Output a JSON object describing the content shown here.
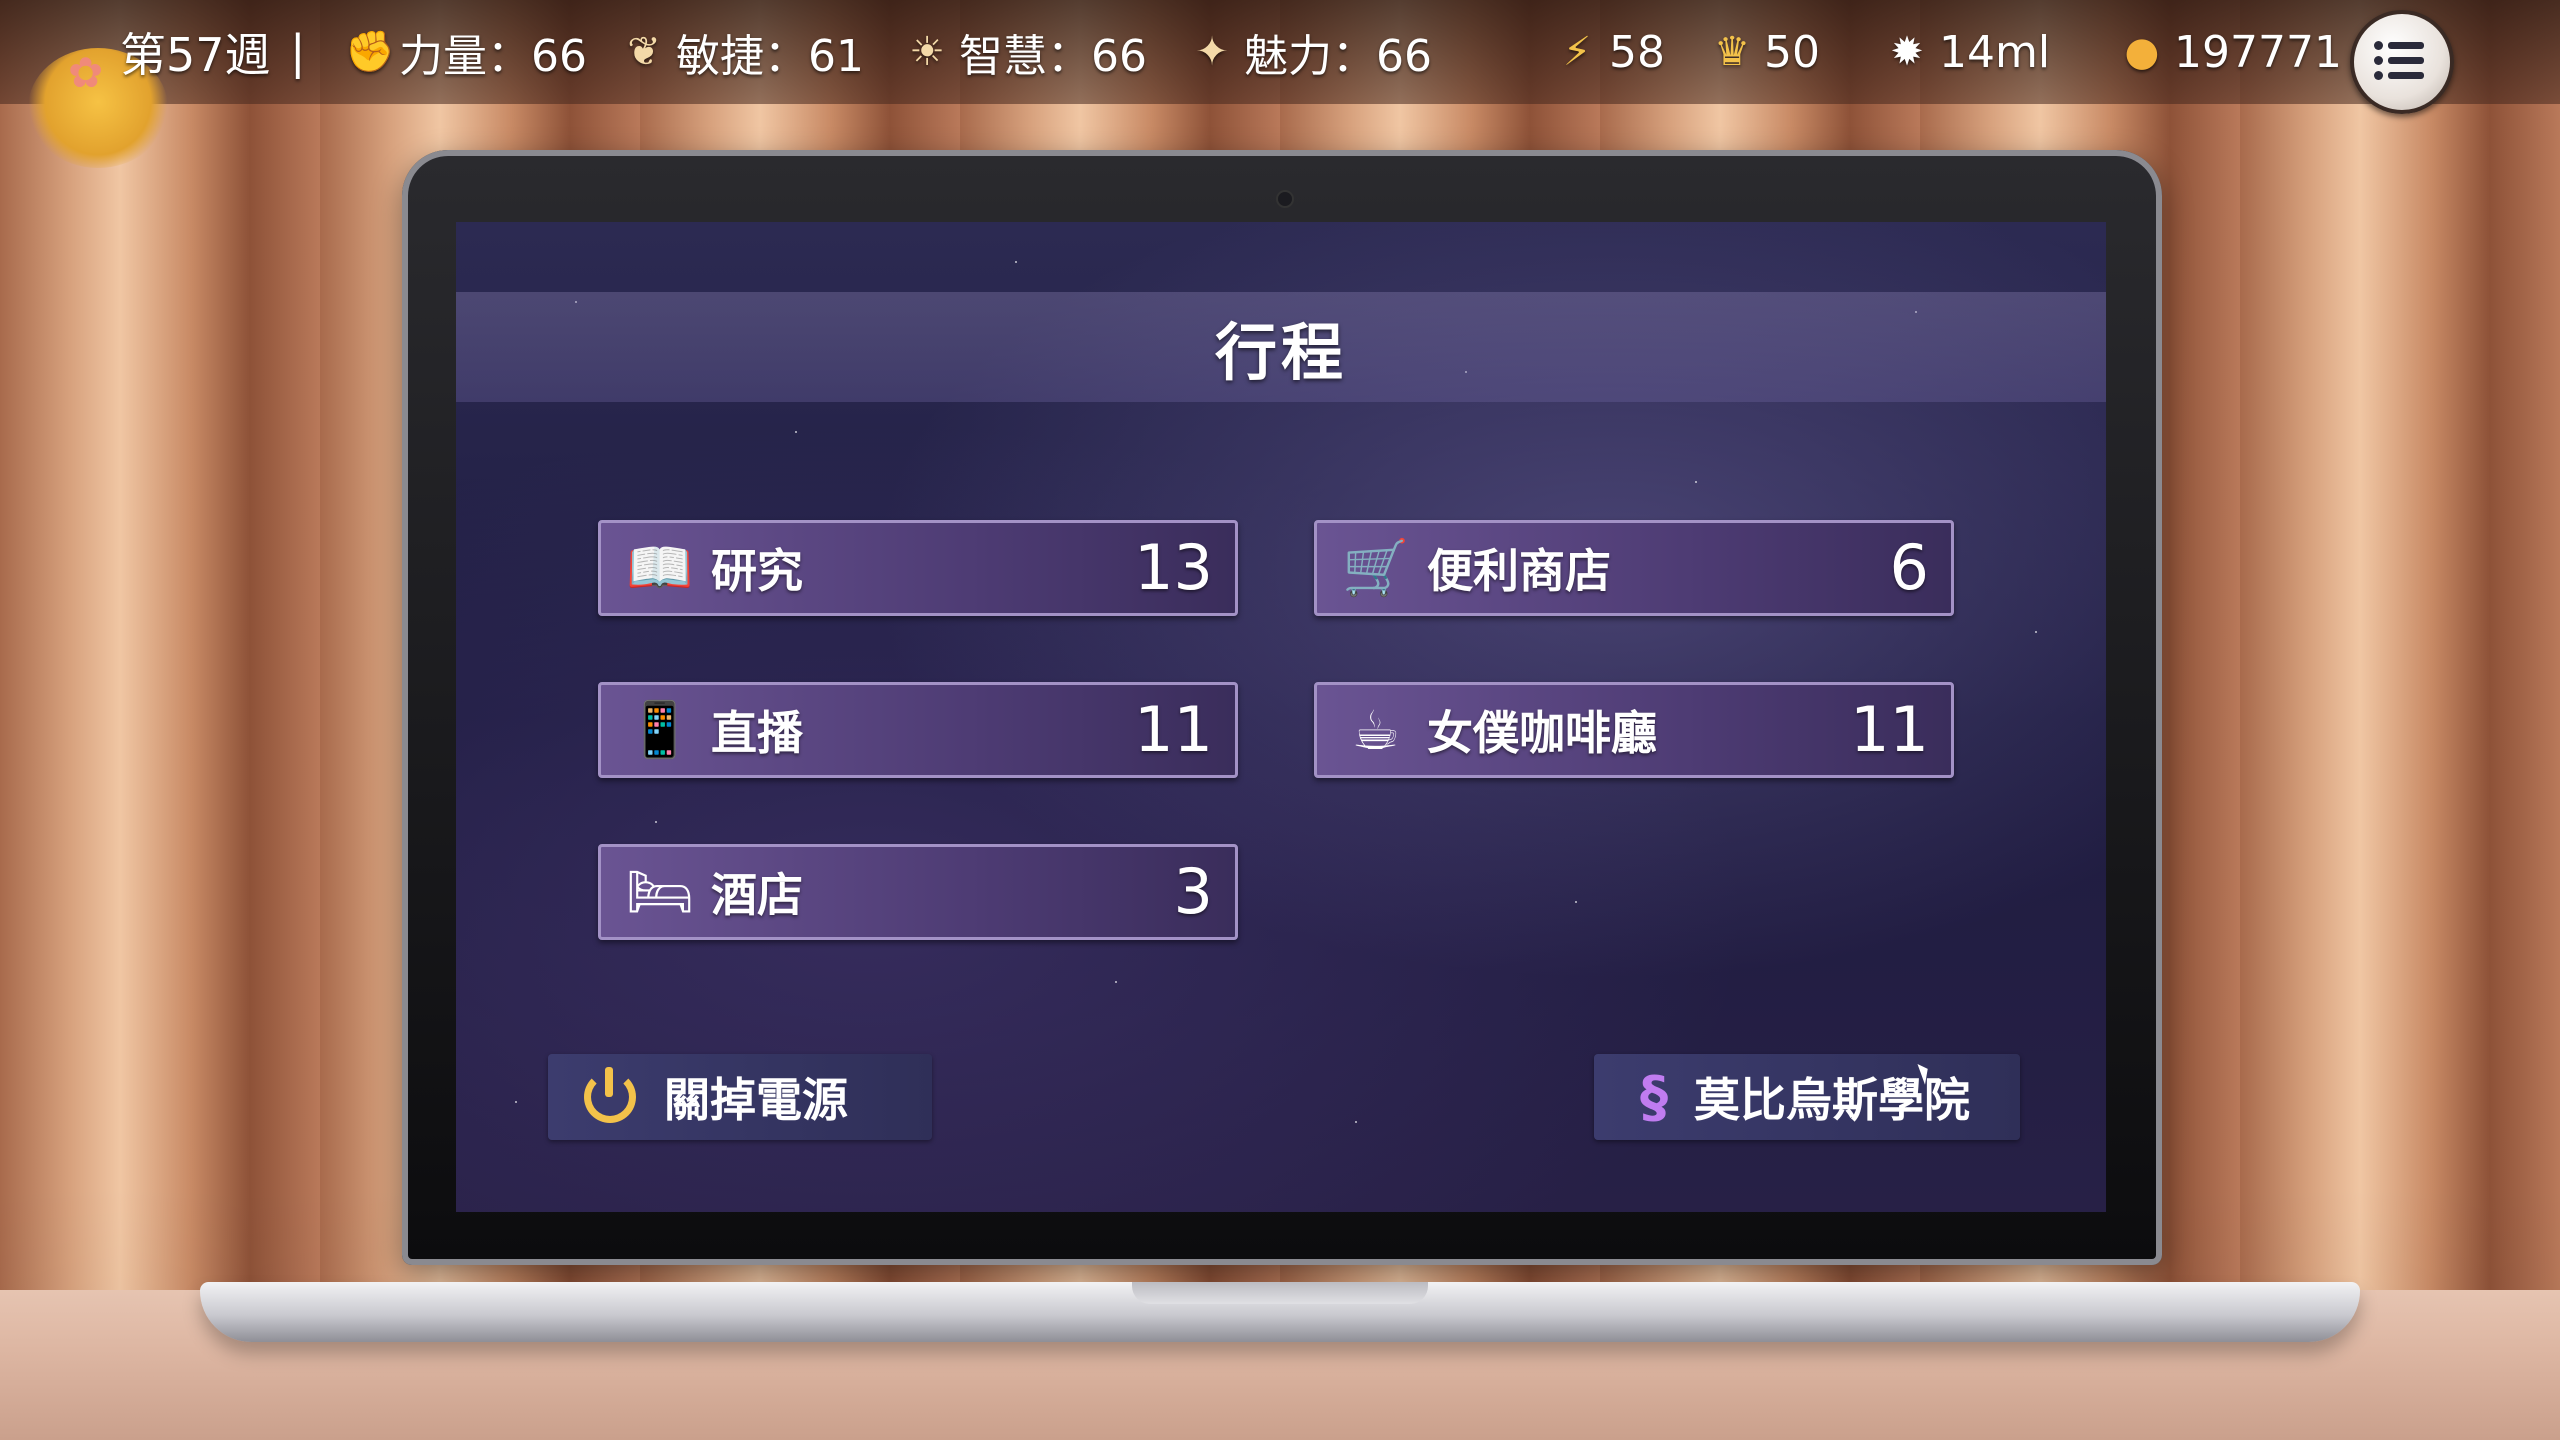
{
  "topbar": {
    "week": "第57週",
    "separator": "|",
    "stats": {
      "strength": "力量：66",
      "agility": "敏捷：61",
      "wisdom": "智慧：66",
      "charm": "魅力：66"
    },
    "energy": "58",
    "popularity": "50",
    "milk": "14ml",
    "gold": "197771",
    "icons": {
      "strength": "fist-icon",
      "agility": "leaf-icon",
      "wisdom": "bulb-icon",
      "charm": "sparkle-icon",
      "energy": "lightning-icon",
      "popularity": "fans-icon",
      "milk": "star-burst-icon",
      "gold": "coin-icon",
      "menu": "list-menu-icon"
    }
  },
  "screen": {
    "title": "行程",
    "schedule": [
      {
        "label": "研究",
        "count": "13",
        "icon": "book-icon"
      },
      {
        "label": "便利商店",
        "count": "6",
        "icon": "shopping-cart-icon"
      },
      {
        "label": "直播",
        "count": "11",
        "icon": "smartphone-icon"
      },
      {
        "label": "女僕咖啡廳",
        "count": "11",
        "icon": "coffee-cup-icon"
      },
      {
        "label": "酒店",
        "count": "3",
        "icon": "bed-icon"
      }
    ],
    "power_button": "關掉電源",
    "academy_button": "莫比烏斯學院"
  },
  "colors": {
    "button_border": "#a392c6",
    "button_fill": "#5a4683",
    "screen_bg": "#24224a",
    "gold": "#f3c24a"
  }
}
